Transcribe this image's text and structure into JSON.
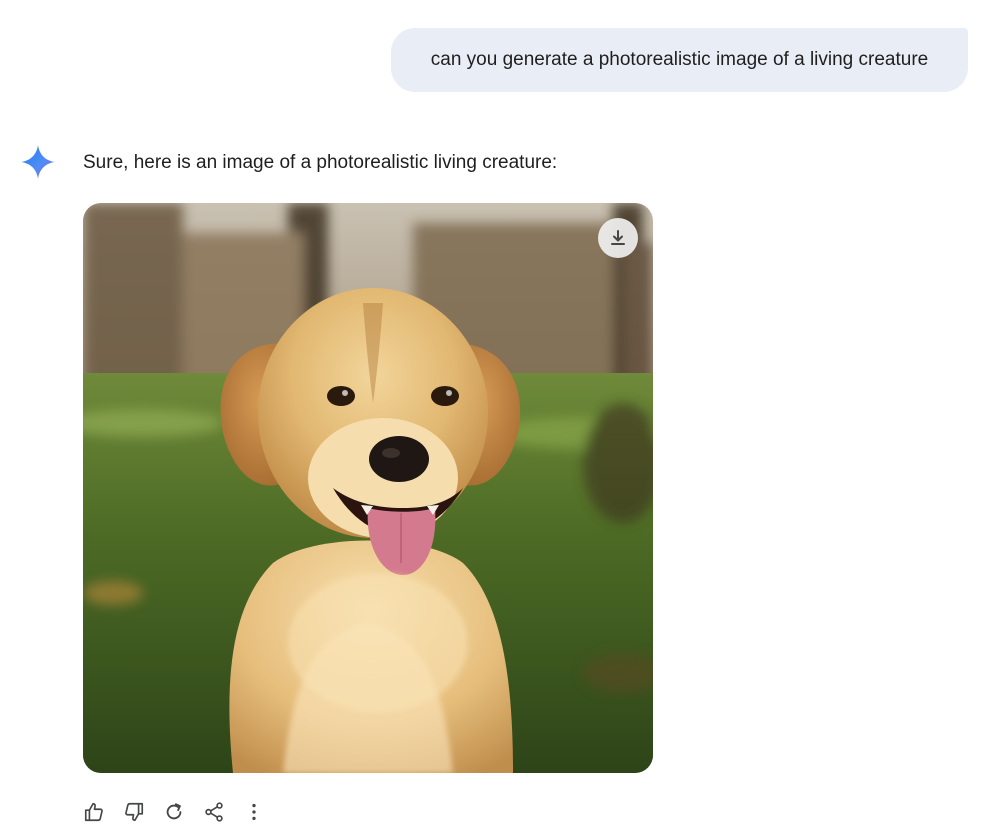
{
  "conversation": {
    "user_prompt": "can you generate a photorealistic image of a living creature",
    "response_text": "Sure, here is an image of a photorealistic living creature:"
  },
  "image": {
    "subject_icon": "golden-retriever-photo",
    "download_icon": "download-icon"
  },
  "actions": {
    "icons": [
      "thumb-up-icon",
      "thumb-down-icon",
      "regenerate-icon",
      "share-icon",
      "more-options-icon"
    ]
  },
  "colors": {
    "user_bubble": "#e9eef6",
    "text": "#1f1f1f",
    "gemini_blue": "#4285f4",
    "icon_gray": "#444746"
  }
}
